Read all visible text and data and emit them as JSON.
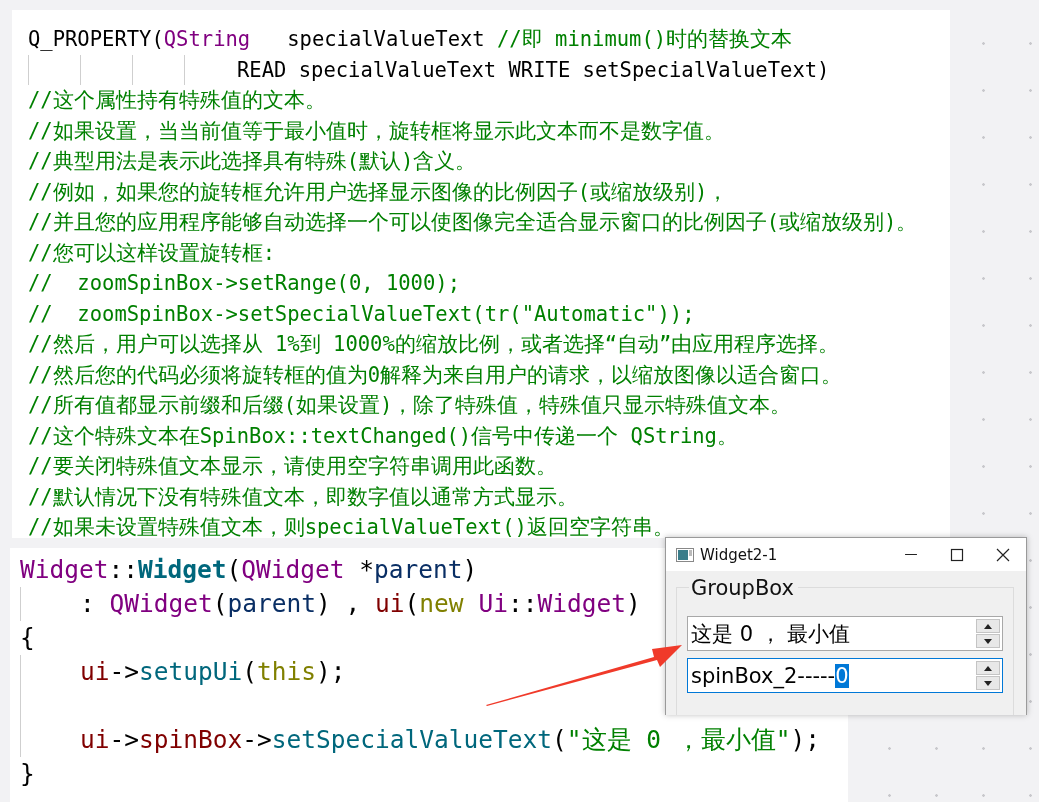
{
  "doc_code": {
    "lines": [
      {
        "indent": false,
        "segments": [
          {
            "kind": "plain",
            "text": "Q_PROPERTY("
          },
          {
            "kind": "type",
            "text": "QString"
          },
          {
            "kind": "plain",
            "text": "   specialValueText "
          },
          {
            "kind": "comment",
            "text": "//即 minimum()时的替换文本"
          }
        ]
      },
      {
        "indent": true,
        "segments": [
          {
            "kind": "plain",
            "text": "READ specialValueText WRITE setSpecialValueText)"
          }
        ]
      },
      {
        "indent": false,
        "segments": [
          {
            "kind": "comment",
            "text": "//这个属性持有特殊值的文本。"
          }
        ]
      },
      {
        "indent": false,
        "segments": [
          {
            "kind": "comment",
            "text": "//如果设置，当当前值等于最小值时，旋转框将显示此文本而不是数字值。"
          }
        ]
      },
      {
        "indent": false,
        "segments": [
          {
            "kind": "comment",
            "text": "//典型用法是表示此选择具有特殊(默认)含义。"
          }
        ]
      },
      {
        "indent": false,
        "segments": [
          {
            "kind": "comment",
            "text": "//例如，如果您的旋转框允许用户选择显示图像的比例因子(或缩放级别)，"
          }
        ]
      },
      {
        "indent": false,
        "segments": [
          {
            "kind": "comment",
            "text": "//并且您的应用程序能够自动选择一个可以使图像完全适合显示窗口的比例因子(或缩放级别)。"
          }
        ]
      },
      {
        "indent": false,
        "segments": [
          {
            "kind": "comment",
            "text": "//您可以这样设置旋转框:"
          }
        ]
      },
      {
        "indent": false,
        "segments": [
          {
            "kind": "comment",
            "text": "//  zoomSpinBox->setRange(0, 1000);"
          }
        ]
      },
      {
        "indent": false,
        "segments": [
          {
            "kind": "comment",
            "text": "//  zoomSpinBox->setSpecialValueText(tr(\"Automatic\"));"
          }
        ]
      },
      {
        "indent": false,
        "segments": [
          {
            "kind": "comment",
            "text": "//然后，用户可以选择从 1%到 1000%的缩放比例，或者选择“自动”由应用程序选择。"
          }
        ]
      },
      {
        "indent": false,
        "segments": [
          {
            "kind": "comment",
            "text": "//然后您的代码必须将旋转框的值为0解释为来自用户的请求，以缩放图像以适合窗口。"
          }
        ]
      },
      {
        "indent": false,
        "segments": [
          {
            "kind": "comment",
            "text": "//所有值都显示前缀和后缀(如果设置)，除了特殊值，特殊值只显示特殊值文本。"
          }
        ]
      },
      {
        "indent": false,
        "segments": [
          {
            "kind": "comment",
            "text": "//这个特殊文本在SpinBox::textChanged()信号中传递一个 QString。"
          }
        ]
      },
      {
        "indent": false,
        "segments": [
          {
            "kind": "comment",
            "text": "//要关闭特殊值文本显示，请使用空字符串调用此函数。"
          }
        ]
      },
      {
        "indent": false,
        "segments": [
          {
            "kind": "comment",
            "text": "//默认情况下没有特殊值文本，即数字值以通常方式显示。"
          }
        ]
      },
      {
        "indent": false,
        "segments": [
          {
            "kind": "comment",
            "text": "//如果未设置特殊值文本，则specialValueText()返回空字符串。"
          }
        ]
      }
    ]
  },
  "source_code": {
    "lines": [
      {
        "indent": false,
        "segments": [
          {
            "kind": "type",
            "text": "Widget"
          },
          {
            "kind": "plain",
            "text": "::"
          },
          {
            "kind": "function_bold",
            "text": "Widget"
          },
          {
            "kind": "plain",
            "text": "("
          },
          {
            "kind": "type",
            "text": "QWidget"
          },
          {
            "kind": "plain",
            "text": " *"
          },
          {
            "kind": "param",
            "text": "parent"
          },
          {
            "kind": "plain",
            "text": ")"
          }
        ]
      },
      {
        "indent": true,
        "segments": [
          {
            "kind": "plain",
            "text": ": "
          },
          {
            "kind": "type",
            "text": "QWidget"
          },
          {
            "kind": "plain",
            "text": "("
          },
          {
            "kind": "param",
            "text": "parent"
          },
          {
            "kind": "plain",
            "text": ") , "
          },
          {
            "kind": "member",
            "text": "ui"
          },
          {
            "kind": "plain",
            "text": "("
          },
          {
            "kind": "keyword",
            "text": "new"
          },
          {
            "kind": "type",
            "text": " Ui"
          },
          {
            "kind": "plain",
            "text": "::"
          },
          {
            "kind": "type",
            "text": "Widget"
          },
          {
            "kind": "plain",
            "text": ")"
          }
        ]
      },
      {
        "indent": false,
        "segments": [
          {
            "kind": "plain",
            "text": "{"
          }
        ]
      },
      {
        "indent": true,
        "segments": [
          {
            "kind": "member",
            "text": "ui"
          },
          {
            "kind": "plain",
            "text": "->"
          },
          {
            "kind": "function",
            "text": "setupUi"
          },
          {
            "kind": "plain",
            "text": "("
          },
          {
            "kind": "keyword",
            "text": "this"
          },
          {
            "kind": "plain",
            "text": ");"
          }
        ]
      },
      {
        "indent": true
      },
      {
        "indent": true,
        "segments": [
          {
            "kind": "member",
            "text": "ui"
          },
          {
            "kind": "plain",
            "text": "->"
          },
          {
            "kind": "member",
            "text": "spinBox"
          },
          {
            "kind": "plain",
            "text": "->"
          },
          {
            "kind": "function",
            "text": "setSpecialValueText"
          },
          {
            "kind": "plain",
            "text": "("
          },
          {
            "kind": "string",
            "text": "\"这是 0 ，最小值\""
          },
          {
            "kind": "plain",
            "text": ");"
          }
        ]
      },
      {
        "indent": false,
        "segments": [
          {
            "kind": "plain",
            "text": "}"
          }
        ]
      }
    ]
  },
  "window": {
    "title": "Widget2-1",
    "group_box": {
      "title": "GroupBox",
      "spin_boxes": [
        {
          "text": "这是 0 ， 最小值",
          "focused": false
        },
        {
          "text": "spinBox_2-----",
          "selected_text": "0",
          "focused": true
        }
      ]
    }
  }
}
